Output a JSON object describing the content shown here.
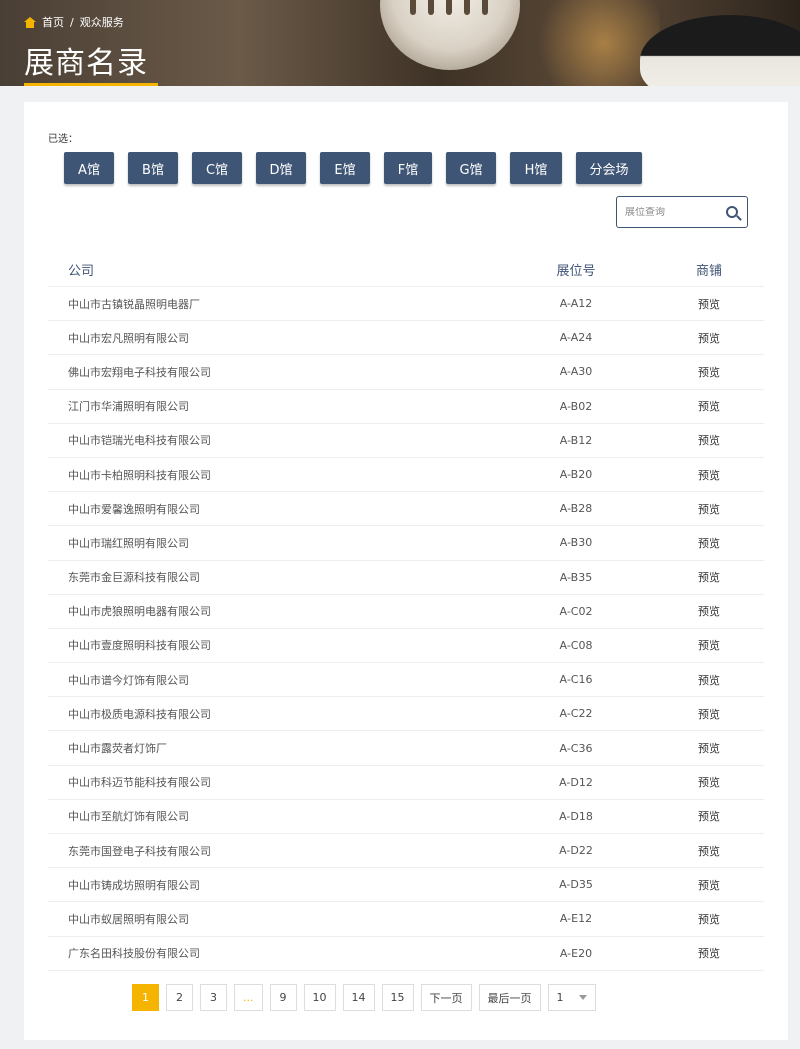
{
  "breadcrumb": {
    "home": "首页",
    "separator": "/",
    "current": "观众服务"
  },
  "page_title": "展商名录",
  "filter": {
    "selected_label": "已选：",
    "halls": [
      "A馆",
      "B馆",
      "C馆",
      "D馆",
      "E馆",
      "F馆",
      "G馆",
      "H馆",
      "分会场"
    ]
  },
  "search": {
    "placeholder": "展位查询"
  },
  "table": {
    "headers": {
      "company": "公司",
      "booth": "展位号",
      "shop": "商铺"
    },
    "rows": [
      {
        "company": "中山市古镇锐晶照明电器厂",
        "booth": "A-A12",
        "action": "预览"
      },
      {
        "company": "中山市宏凡照明有限公司",
        "booth": "A-A24",
        "action": "预览"
      },
      {
        "company": "佛山市宏翔电子科技有限公司",
        "booth": "A-A30",
        "action": "预览"
      },
      {
        "company": "江门市华浦照明有限公司",
        "booth": "A-B02",
        "action": "预览"
      },
      {
        "company": "中山市铠瑞光电科技有限公司",
        "booth": "A-B12",
        "action": "预览"
      },
      {
        "company": "中山市卡柏照明科技有限公司",
        "booth": "A-B20",
        "action": "预览"
      },
      {
        "company": "中山市爱馨逸照明有限公司",
        "booth": "A-B28",
        "action": "预览"
      },
      {
        "company": "中山市瑞红照明有限公司",
        "booth": "A-B30",
        "action": "预览"
      },
      {
        "company": "东莞市金巨源科技有限公司",
        "booth": "A-B35",
        "action": "预览"
      },
      {
        "company": "中山市虎狼照明电器有限公司",
        "booth": "A-C02",
        "action": "预览"
      },
      {
        "company": "中山市壹度照明科技有限公司",
        "booth": "A-C08",
        "action": "预览"
      },
      {
        "company": "中山市谱今灯饰有限公司",
        "booth": "A-C16",
        "action": "预览"
      },
      {
        "company": "中山市极质电源科技有限公司",
        "booth": "A-C22",
        "action": "预览"
      },
      {
        "company": "中山市露荧者灯饰厂",
        "booth": "A-C36",
        "action": "预览"
      },
      {
        "company": "中山市科迈节能科技有限公司",
        "booth": "A-D12",
        "action": "预览"
      },
      {
        "company": "中山市至航灯饰有限公司",
        "booth": "A-D18",
        "action": "预览"
      },
      {
        "company": "东莞市国登电子科技有限公司",
        "booth": "A-D22",
        "action": "预览"
      },
      {
        "company": "中山市铸成坊照明有限公司",
        "booth": "A-D35",
        "action": "预览"
      },
      {
        "company": "中山市蚁居照明有限公司",
        "booth": "A-E12",
        "action": "预览"
      },
      {
        "company": "广东名田科技股份有限公司",
        "booth": "A-E20",
        "action": "预览"
      }
    ]
  },
  "pagination": {
    "pages": [
      "1",
      "2",
      "3",
      "...",
      "9",
      "10",
      "14",
      "15"
    ],
    "current": "1",
    "next": "下一页",
    "last": "最后一页",
    "jump_value": "1"
  },
  "colors": {
    "accent": "#f5b400",
    "primary": "#3f5575"
  }
}
